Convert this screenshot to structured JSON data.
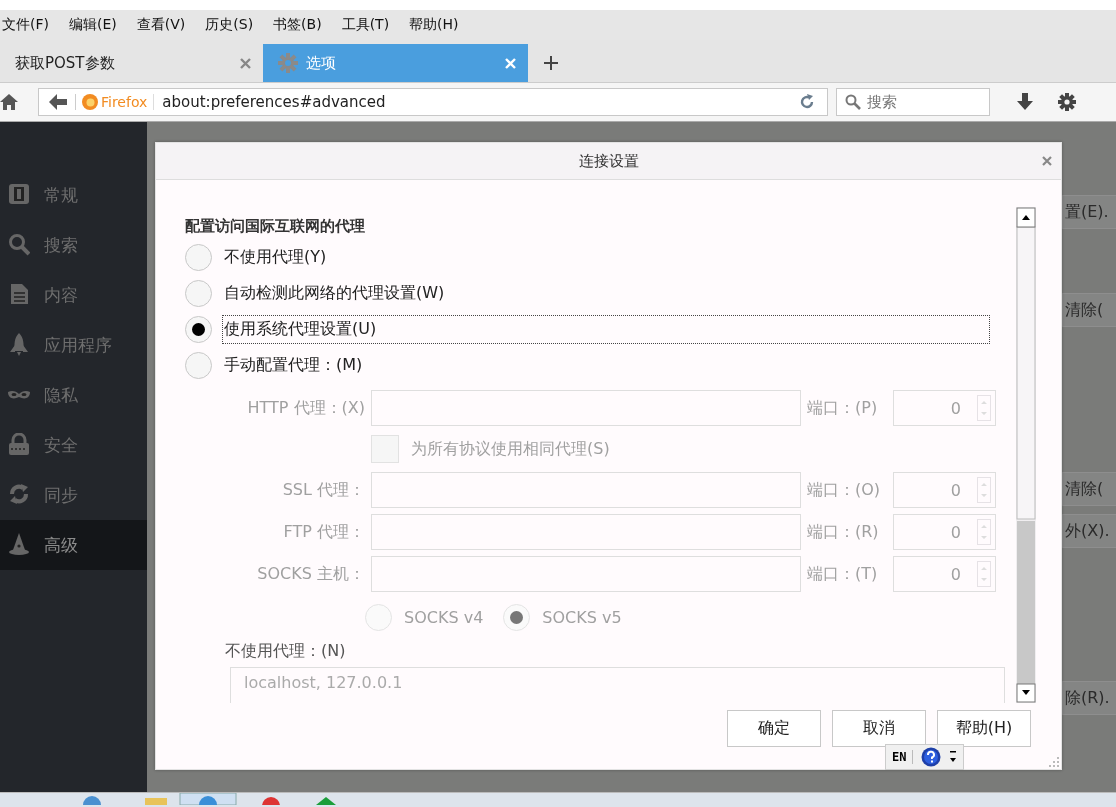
{
  "menu": [
    {
      "label": "文件(F)"
    },
    {
      "label": "编辑(E)"
    },
    {
      "label": "查看(V)"
    },
    {
      "label": "历史(S)"
    },
    {
      "label": "书签(B)"
    },
    {
      "label": "工具(T)"
    },
    {
      "label": "帮助(H)"
    }
  ],
  "tabs": [
    {
      "label": "获取POST参数",
      "selected": false,
      "kind": "page"
    },
    {
      "label": "选项",
      "selected": true,
      "kind": "settings"
    }
  ],
  "address": {
    "identity": "Firefox",
    "url": "about:preferences#advanced"
  },
  "search": {
    "placeholder": "搜索"
  },
  "sidebar": {
    "items": [
      {
        "label": "常规",
        "kind": "general",
        "selected": false
      },
      {
        "label": "搜索",
        "kind": "search",
        "selected": false
      },
      {
        "label": "内容",
        "kind": "content",
        "selected": false
      },
      {
        "label": "应用程序",
        "kind": "apps",
        "selected": false
      },
      {
        "label": "隐私",
        "kind": "privacy",
        "selected": false
      },
      {
        "label": "安全",
        "kind": "security",
        "selected": false
      },
      {
        "label": "同步",
        "kind": "sync",
        "selected": false
      },
      {
        "label": "高级",
        "kind": "advanced",
        "selected": true
      }
    ]
  },
  "background_buttons": [
    {
      "label": "置(E)."
    },
    {
      "label": "清除("
    },
    {
      "label": "清除("
    },
    {
      "label": "外(X)."
    },
    {
      "label": "除(R)."
    }
  ],
  "dialog": {
    "title": "连接设置",
    "heading": "配置访问国际互联网的代理",
    "proxy_modes": [
      {
        "label": "不使用代理(Y)",
        "selected": false,
        "focused": false
      },
      {
        "label": "自动检测此网络的代理设置(W)",
        "selected": false,
        "focused": false
      },
      {
        "label": "使用系统代理设置(U)",
        "selected": true,
        "focused": true
      },
      {
        "label": "手动配置代理：(M)",
        "selected": false,
        "focused": false
      }
    ],
    "manual": {
      "disabled": true,
      "fields": [
        {
          "kind": "proxy",
          "label": "HTTP 代理：(X)",
          "port_label": "端口：(P)",
          "port": "0"
        },
        {
          "kind": "same",
          "label": "为所有协议使用相同代理(S)",
          "checked": false
        },
        {
          "kind": "proxy",
          "label": "SSL 代理：",
          "port_label": "端口：(O)",
          "port": "0"
        },
        {
          "kind": "proxy",
          "label": "FTP 代理：",
          "port_label": "端口：(R)",
          "port": "0"
        },
        {
          "kind": "proxy",
          "label": "SOCKS 主机：",
          "port_label": "端口：(T)",
          "port": "0"
        }
      ],
      "socks_versions": [
        {
          "label": "SOCKS v4",
          "selected": false
        },
        {
          "label": "SOCKS v5",
          "selected": true
        }
      ]
    },
    "no_proxy": {
      "label": "不使用代理：(N)",
      "value": "localhost, 127.0.0.1"
    },
    "buttons": [
      {
        "label": "确定"
      },
      {
        "label": "取消"
      },
      {
        "label": "帮助(H)"
      }
    ]
  },
  "ime_bar": {
    "language": "EN"
  }
}
